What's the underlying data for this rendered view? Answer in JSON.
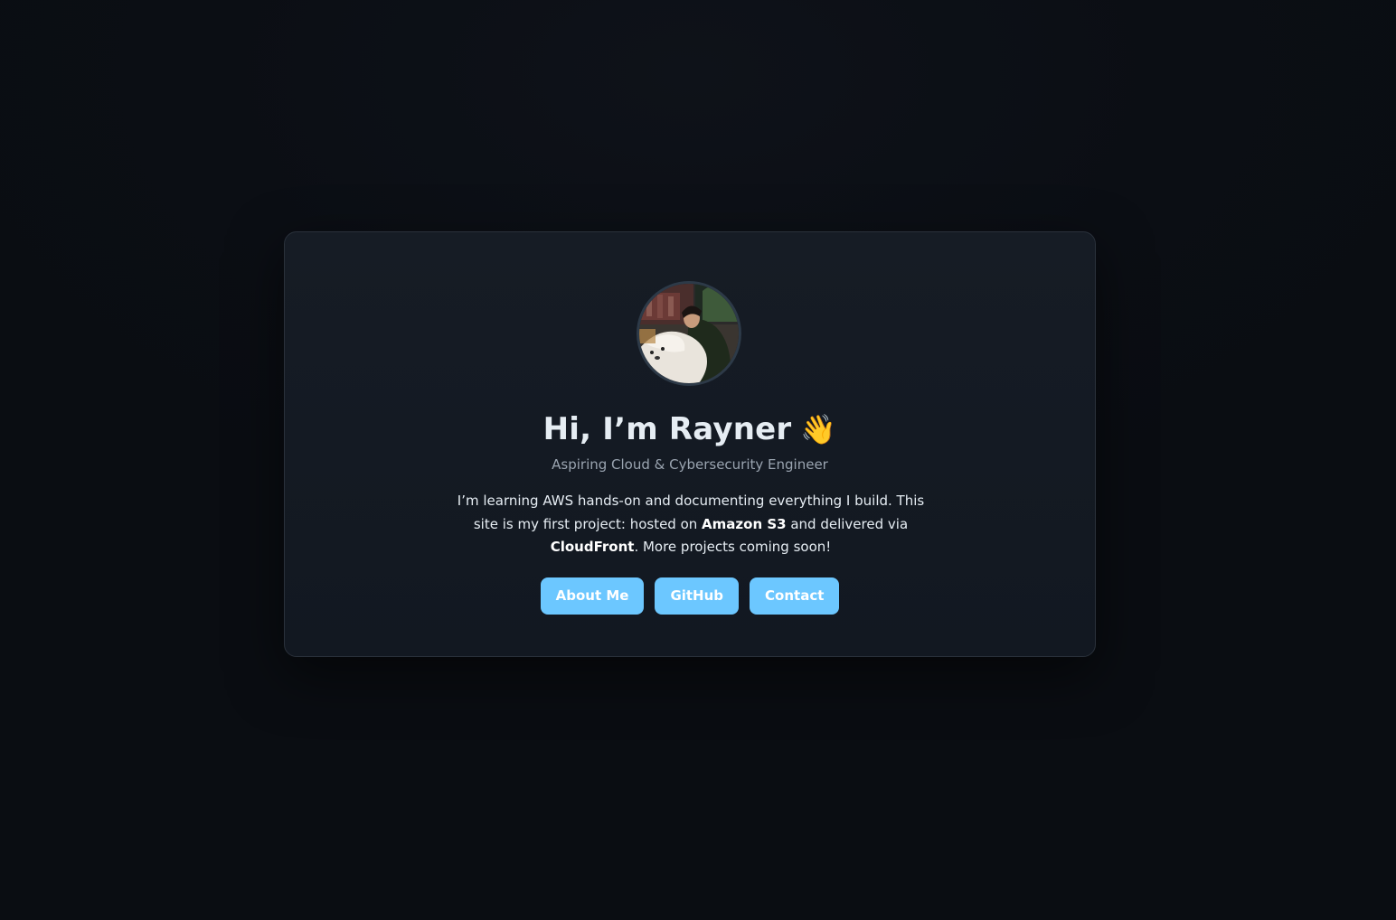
{
  "profile": {
    "avatar_alt": "profile photo",
    "greeting": "Hi, I’m Rayner",
    "wave_emoji": "👋",
    "subtitle": "Aspiring Cloud & Cybersecurity Engineer"
  },
  "description": {
    "part1": "I’m learning AWS hands-on and documenting everything I build. This site is my first project: hosted on ",
    "highlight1": "Amazon S3",
    "part2": " and delivered via ",
    "highlight2": "CloudFront",
    "part3": ". More projects coming soon!"
  },
  "buttons": {
    "about": "About Me",
    "github": "GitHub",
    "contact": "Contact"
  },
  "colors": {
    "background": "#0b0e14",
    "card": "#141a23",
    "accent": "#6cc7ff",
    "text": "#e6edf3",
    "muted": "#9aa4b0"
  }
}
